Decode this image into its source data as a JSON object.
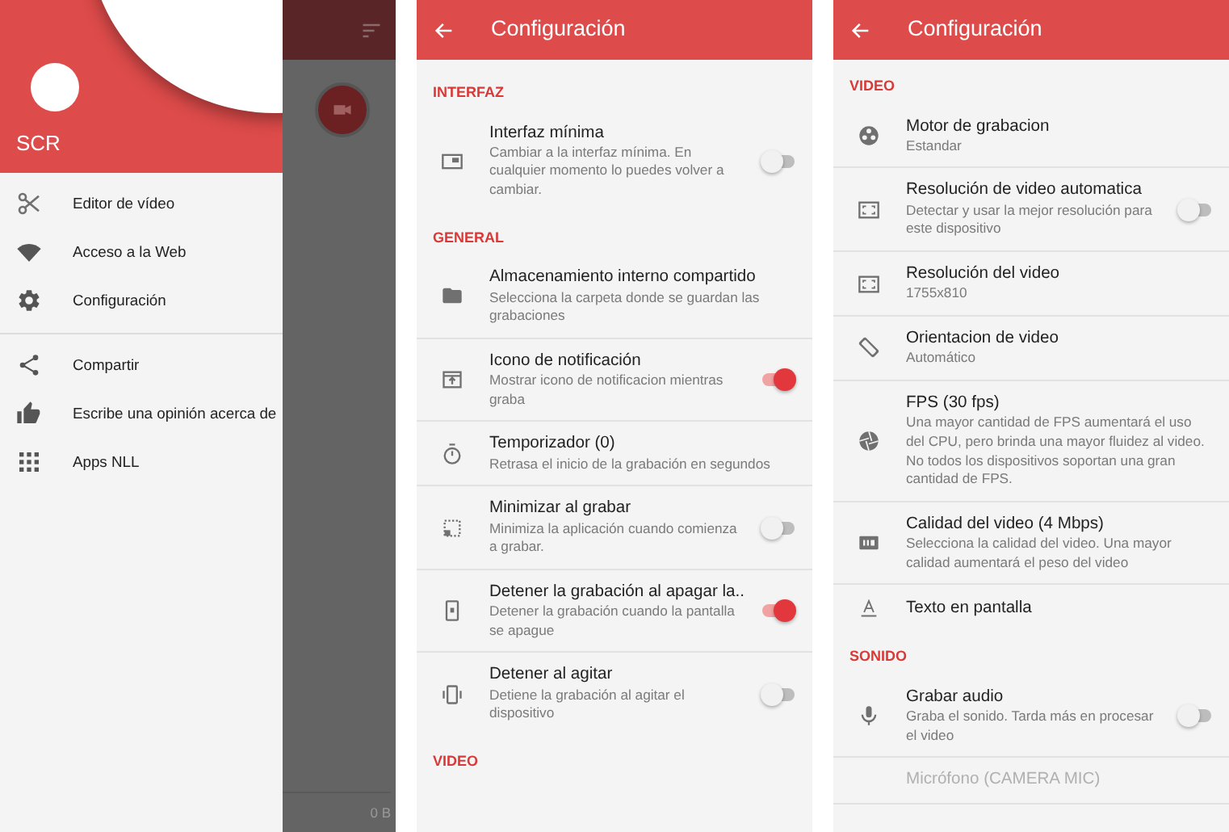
{
  "screens": [
    {
      "kind": "drawer",
      "header": {
        "title": "SCR"
      },
      "menu_groups": [
        {
          "items": [
            {
              "label": "Editor de vídeo"
            },
            {
              "label": "Acceso a la Web"
            },
            {
              "label": "Configuración"
            }
          ]
        },
        {
          "items": [
            {
              "label": "Compartir"
            },
            {
              "label": "Escribe una opinión acerca de"
            },
            {
              "label": "Apps NLL"
            }
          ]
        }
      ],
      "backdrop": {
        "storage": "0 B"
      }
    },
    {
      "kind": "settings",
      "title": "Configuración",
      "sections": [
        {
          "title": "INTERFAZ",
          "items": [
            {
              "kind": "switch",
              "title": "Interfaz mínima",
              "summary": "Cambiar a la interfaz mínima. En cualquier momento lo puedes volver a cambiar.",
              "on": false,
              "disabled": false
            }
          ]
        },
        {
          "title": "GENERAL",
          "items": [
            {
              "kind": "plain",
              "title": "Almacenamiento interno compartido",
              "summary": "Selecciona la carpeta donde se guardan las grabaciones",
              "disabled": false
            },
            {
              "kind": "switch",
              "title": "Icono de notificación",
              "summary": "Mostrar icono de notificacion mientras graba",
              "on": true,
              "disabled": false
            },
            {
              "kind": "plain",
              "title": "Temporizador (0)",
              "summary": "Retrasa el inicio de la grabación en segundos",
              "disabled": false
            },
            {
              "kind": "switch",
              "title": "Minimizar al grabar",
              "summary": "Minimiza la aplicación cuando comienza a grabar.",
              "on": false,
              "disabled": false
            },
            {
              "kind": "switch",
              "title": "Detener la grabación al apagar la..",
              "summary": "Detener la grabación cuando la pantalla se apague",
              "on": true,
              "disabled": false
            },
            {
              "kind": "switch",
              "title": "Detener al agitar",
              "summary": "Detiene la grabación al agitar el dispositivo",
              "on": false,
              "disabled": false
            }
          ]
        },
        {
          "title": "VIDEO"
        }
      ]
    },
    {
      "kind": "settings",
      "title": "Configuración",
      "sections": [
        {
          "title": "VIDEO",
          "items": [
            {
              "kind": "plain",
              "title": "Motor de grabacion",
              "summary": "Estandar",
              "disabled": false
            },
            {
              "kind": "switch",
              "title": "Resolución de video automatica",
              "summary": "Detectar y usar la mejor resolución para este dispositivo",
              "on": false,
              "disabled": false
            },
            {
              "kind": "plain",
              "title": "Resolución del video",
              "summary": "1755x810",
              "disabled": false
            },
            {
              "kind": "plain",
              "title": "Orientacion de video",
              "summary": "Automático",
              "disabled": false
            },
            {
              "kind": "plain",
              "title": "FPS (30 fps)",
              "summary": "Una mayor cantidad de FPS aumentará el uso del CPU, pero brinda una mayor fluidez al video. No todos los dispositivos soportan una gran cantidad de FPS.",
              "disabled": false
            },
            {
              "kind": "plain",
              "title": "Calidad del video (4 Mbps)",
              "summary": "Selecciona la calidad del video. Una mayor calidad aumentará el peso del video",
              "disabled": false
            },
            {
              "kind": "plain",
              "title": "Texto en pantalla",
              "disabled": false
            }
          ]
        },
        {
          "title": "SONIDO",
          "items": [
            {
              "kind": "switch",
              "title": "Grabar audio",
              "summary": "Graba el sonido. Tarda más en procesar el video",
              "on": false,
              "disabled": false
            },
            {
              "kind": "plain",
              "title": "Micrófono (CAMERA MIC)",
              "disabled": true
            }
          ]
        }
      ]
    }
  ]
}
